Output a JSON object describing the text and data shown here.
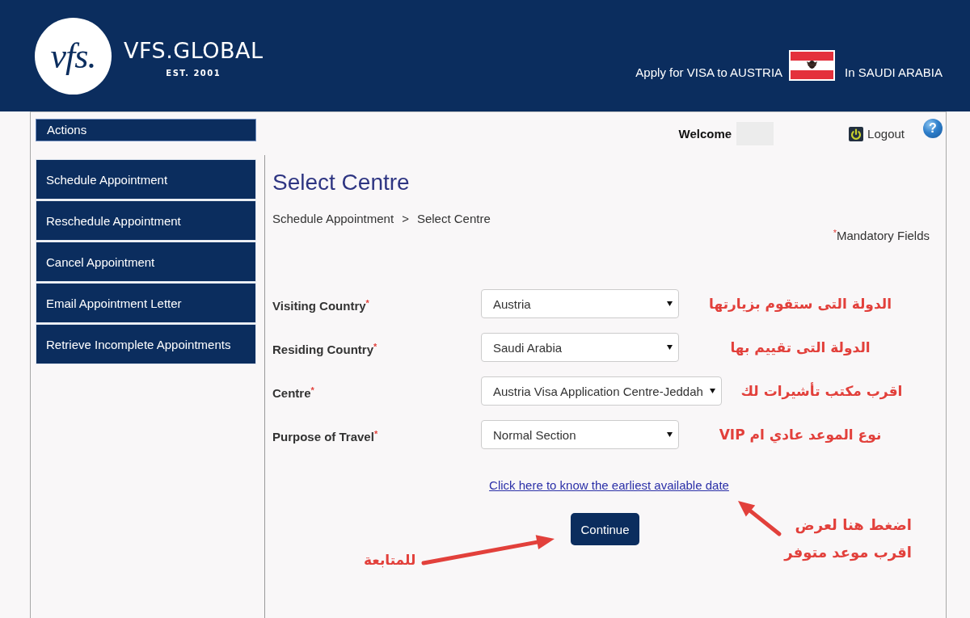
{
  "header": {
    "logo": {
      "monogram": "vfs.",
      "name": "VFS.GLOBAL",
      "established": "EST. 2001"
    },
    "apply_text": "Apply for VISA to AUSTRIA",
    "location_text": "In SAUDI ARABIA"
  },
  "user_bar": {
    "welcome": "Welcome",
    "logout": "Logout",
    "help": "?"
  },
  "sidebar": {
    "title": "Actions",
    "items": [
      {
        "label": "Schedule Appointment"
      },
      {
        "label": "Reschedule Appointment"
      },
      {
        "label": "Cancel Appointment"
      },
      {
        "label": "Email Appointment Letter"
      },
      {
        "label": "Retrieve Incomplete Appointments"
      }
    ]
  },
  "page": {
    "title": "Select Centre",
    "breadcrumb": [
      "Schedule Appointment",
      "Select Centre"
    ],
    "breadcrumb_separator": ">",
    "required_mark": "*",
    "mandatory_note": "Mandatory Fields"
  },
  "form": {
    "fields": [
      {
        "label": "Visiting Country",
        "required": true,
        "value": "Austria",
        "annotation": "الدولة التى ستقوم بزيارتها"
      },
      {
        "label": "Residing Country",
        "required": true,
        "value": "Saudi Arabia",
        "annotation": "الدولة التى تقييم بها"
      },
      {
        "label": "Centre",
        "required": true,
        "value": "Austria Visa Application Centre-Jeddah",
        "annotation": "اقرب مكتب تأشيرات لك"
      },
      {
        "label": "Purpose of Travel",
        "required": true,
        "value": "Normal Section",
        "annotation": "نوع الموعد عادي ام VIP"
      }
    ]
  },
  "earliest_date_link": "Click here to know the earliest available date",
  "continue_button": "Continue",
  "annotations": {
    "continue_note": "للمتابعة",
    "link_note": [
      "اضغط هنا لعرض",
      "اقرب موعد متوفر"
    ]
  }
}
